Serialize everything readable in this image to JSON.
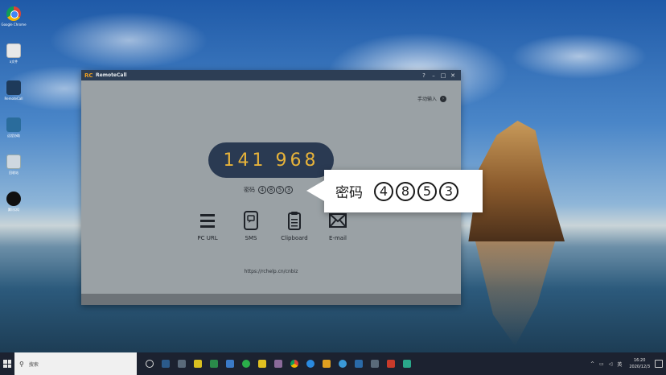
{
  "desktop": {
    "icons": [
      {
        "name": "google-chrome",
        "label": "Google Chrome",
        "icon": "chrome-icon"
      },
      {
        "name": "folder",
        "label": "a文件",
        "icon": "file-icon"
      },
      {
        "name": "remotecall",
        "label": "RemoteCall",
        "icon": "remotecall-icon"
      },
      {
        "name": "remote-app",
        "label": "远程协助",
        "icon": "remote-icon"
      },
      {
        "name": "recycle-bin",
        "label": "回收站",
        "icon": "recycle-bin-icon"
      },
      {
        "name": "qq",
        "label": "腾讯QQ",
        "icon": "qq-icon"
      }
    ]
  },
  "window": {
    "logo": "RC",
    "title": "RemoteCall",
    "controls": {
      "help": "?",
      "minimize": "–",
      "maximize": "□",
      "close": "✕"
    },
    "manual_input": "手动输入",
    "connection_id": "141 968",
    "password_label": "密码",
    "password_digits": [
      "4",
      "8",
      "5",
      "3"
    ],
    "actions": [
      {
        "label": "PC URL",
        "icon": "list-icon"
      },
      {
        "label": "SMS",
        "icon": "phone-message-icon"
      },
      {
        "label": "Clipboard",
        "icon": "clipboard-icon"
      },
      {
        "label": "E-mail",
        "icon": "mail-icon"
      }
    ],
    "url": "https://rchelp.cn/cnbiz"
  },
  "callout": {
    "label": "密码",
    "digits": [
      "4",
      "8",
      "5",
      "3"
    ]
  },
  "taskbar": {
    "search_placeholder": "搜索",
    "time": "16:20",
    "date": "2020/12/3"
  },
  "colors": {
    "titlebar": "#2d3e55",
    "pill": "#2a3a52",
    "pill_text": "#e7b33a",
    "window_bg": "#9aa1a5"
  }
}
